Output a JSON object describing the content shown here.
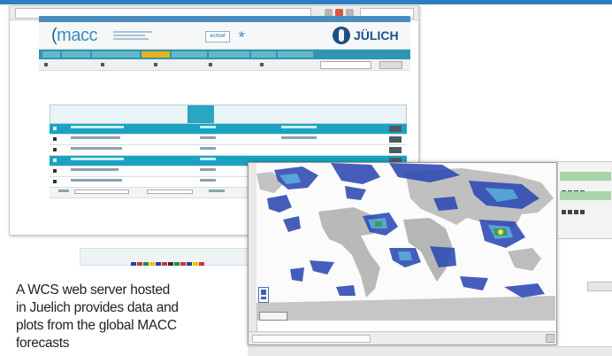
{
  "site": {
    "brand": "macc",
    "partner": "JÜLICH",
    "ecmwf_label": "ecmwf"
  },
  "caption": {
    "lines": [
      "A WCS web server hosted",
      "in Juelich provides data and",
      "plots from the global MACC",
      "forecasts"
    ]
  }
}
